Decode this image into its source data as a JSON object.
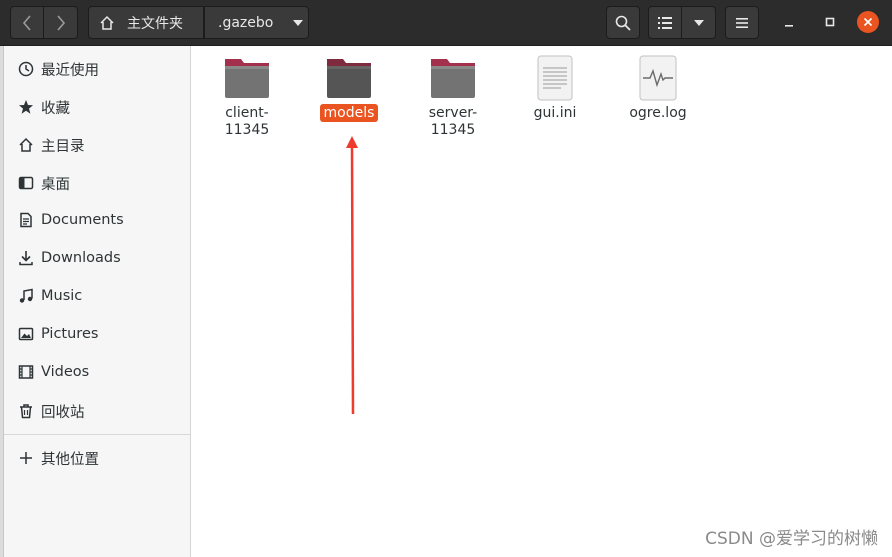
{
  "header": {
    "path": [
      "主文件夹",
      ".gazebo"
    ]
  },
  "sidebar": {
    "items": [
      {
        "label": "最近使用",
        "icon": "clock-icon"
      },
      {
        "label": "收藏",
        "icon": "star-icon"
      },
      {
        "label": "主目录",
        "icon": "home-icon"
      },
      {
        "label": "桌面",
        "icon": "desktop-icon"
      },
      {
        "label": "Documents",
        "icon": "document-icon"
      },
      {
        "label": "Downloads",
        "icon": "download-icon"
      },
      {
        "label": "Music",
        "icon": "music-icon"
      },
      {
        "label": "Pictures",
        "icon": "picture-icon"
      },
      {
        "label": "Videos",
        "icon": "video-icon"
      },
      {
        "label": "回收站",
        "icon": "trash-icon"
      },
      {
        "label": "其他位置",
        "icon": "plus-icon"
      }
    ]
  },
  "files": [
    {
      "name": "client-\n11345",
      "type": "folder",
      "selected": false
    },
    {
      "name": "models",
      "type": "folder",
      "selected": true
    },
    {
      "name": "server-\n11345",
      "type": "folder",
      "selected": false
    },
    {
      "name": "gui.ini",
      "type": "text-file",
      "selected": false
    },
    {
      "name": "ogre.log",
      "type": "log-file",
      "selected": false
    }
  ],
  "watermark": "CSDN @爱学习的树懒",
  "colors": {
    "accent": "#e95420",
    "folder": "#6e6e6e",
    "folder_tab": "#a3304d",
    "headerbar": "#2c2c2c"
  }
}
